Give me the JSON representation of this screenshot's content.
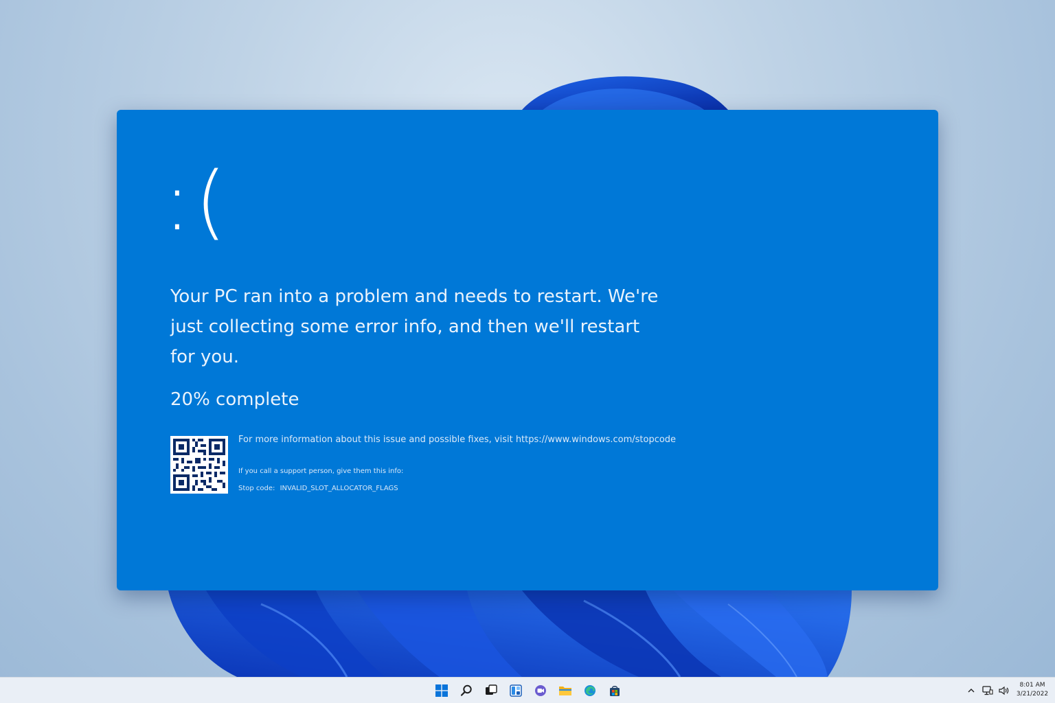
{
  "bsod": {
    "face": ":(",
    "message": "Your PC ran into a problem and needs to restart. We're just collecting some error info, and then we'll restart for you.",
    "progress_text": "20% complete",
    "progress_percent": 20,
    "more_info": "For more information about this issue and possible fixes, visit https://www.windows.com/stopcode",
    "support_hint": "If you call a support person, give them this info:",
    "stop_code_label": "Stop code:",
    "stop_code": "INVALID_SLOT_ALLOCATOR_FLAGS"
  },
  "taskbar": {
    "apps": [
      {
        "icon": "windows-start-icon"
      },
      {
        "icon": "search-icon"
      },
      {
        "icon": "task-view-icon"
      },
      {
        "icon": "widgets-icon"
      },
      {
        "icon": "chat-icon"
      },
      {
        "icon": "file-explorer-icon"
      },
      {
        "icon": "edge-browser-icon"
      },
      {
        "icon": "store-icon"
      }
    ],
    "tray": {
      "icons": [
        "chevron-up-icon",
        "network-icon",
        "volume-icon"
      ]
    },
    "clock": {
      "time": "8:01 AM",
      "date": "3/21/2022"
    }
  },
  "colors": {
    "bsod_blue": "#0078d7",
    "accent": "#0067c0"
  }
}
